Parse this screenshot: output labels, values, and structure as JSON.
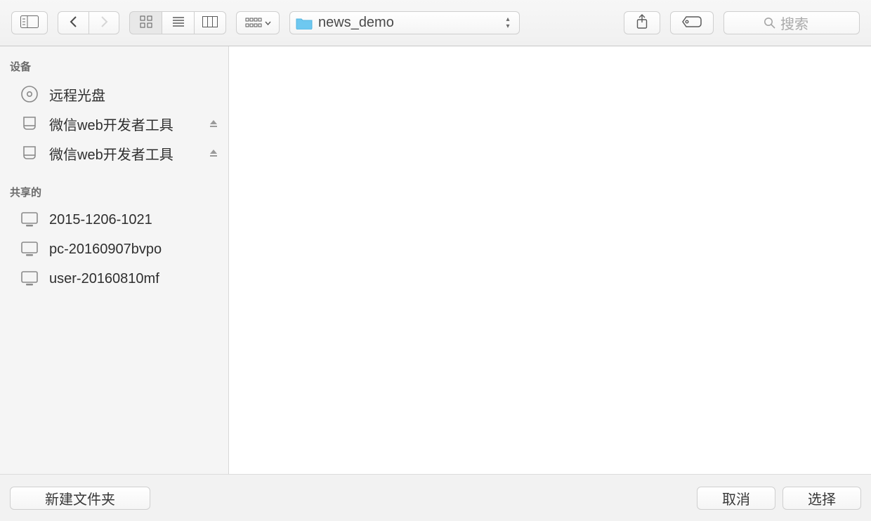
{
  "toolbar": {
    "current_folder": "news_demo",
    "search_placeholder": "搜索"
  },
  "sidebar": {
    "sections": [
      {
        "header": "设备",
        "items": [
          {
            "icon": "disc",
            "label": "远程光盘",
            "eject": false
          },
          {
            "icon": "drive",
            "label": "微信web开发者工具",
            "eject": true
          },
          {
            "icon": "drive",
            "label": "微信web开发者工具",
            "eject": true
          }
        ]
      },
      {
        "header": "共享的",
        "items": [
          {
            "icon": "monitor",
            "label": "2015-1206-1021",
            "eject": false
          },
          {
            "icon": "monitor",
            "label": "pc-20160907bvpo",
            "eject": false
          },
          {
            "icon": "monitor",
            "label": "user-20160810mf",
            "eject": false
          }
        ]
      }
    ]
  },
  "footer": {
    "new_folder": "新建文件夹",
    "cancel": "取消",
    "choose": "选择"
  }
}
